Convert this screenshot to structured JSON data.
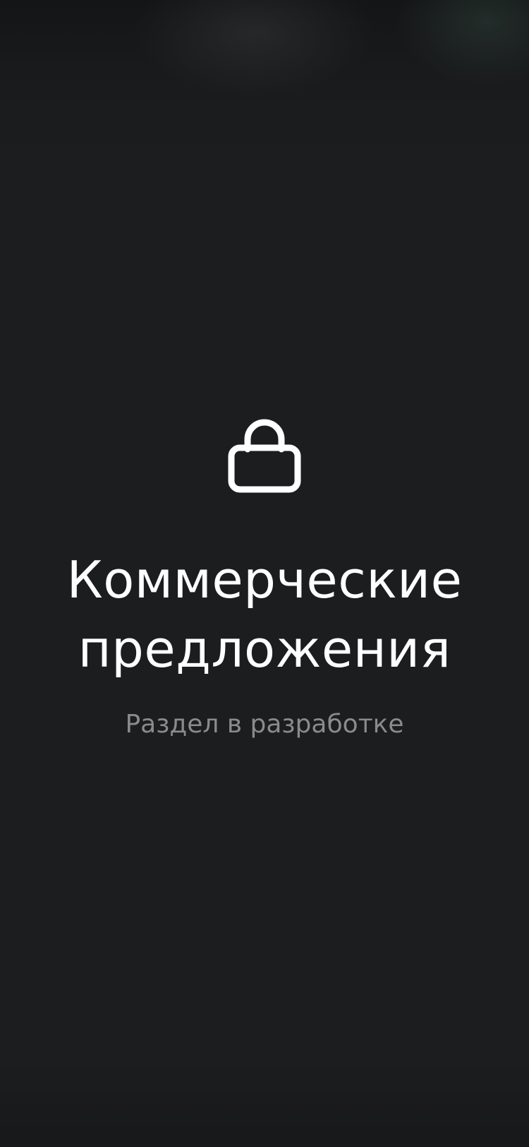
{
  "screen": {
    "icon": "lock-icon",
    "title_line1": "Коммерческие",
    "title_line2": "предложения",
    "subtitle": "Раздел в разработке"
  },
  "colors": {
    "background": "#1c1d1f",
    "title": "#ffffff",
    "subtitle": "#8a8b8d"
  }
}
